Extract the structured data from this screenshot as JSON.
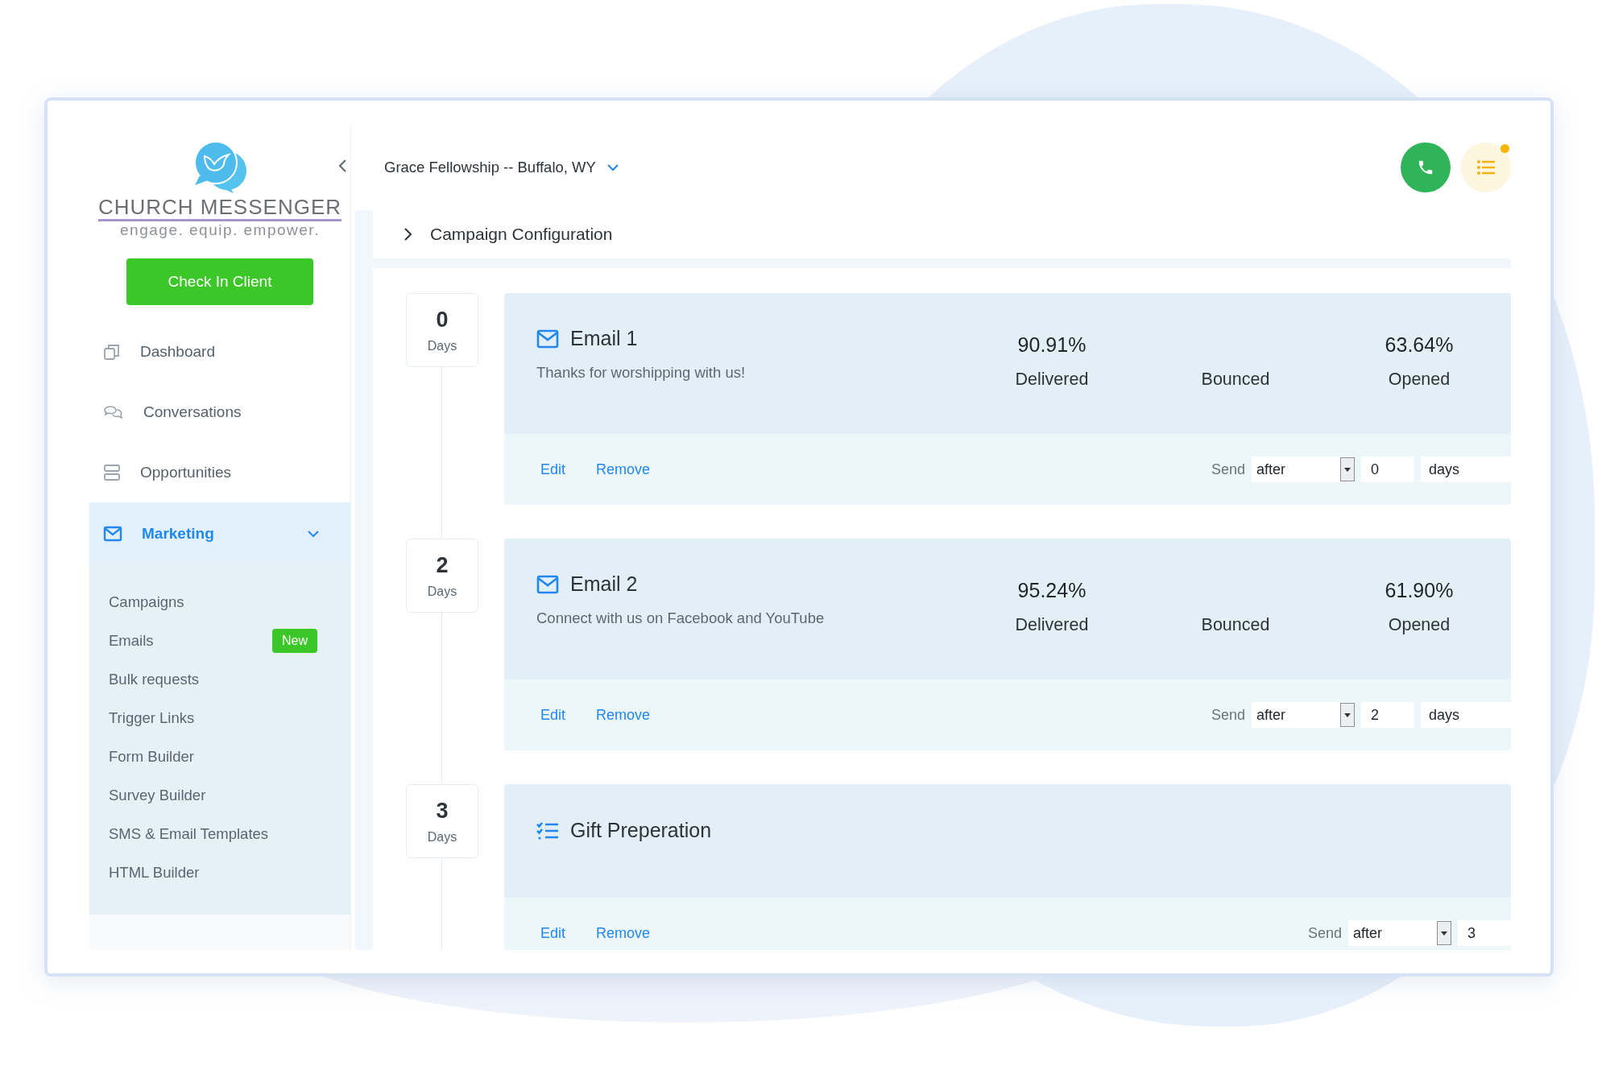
{
  "sidebar": {
    "logo": {
      "name": "CHURCH MESSENGER",
      "tagline": "engage. equip. empower."
    },
    "check_in_button": "Check In Client",
    "nav": [
      {
        "label": "Dashboard",
        "selected": false
      },
      {
        "label": "Conversations",
        "selected": false
      },
      {
        "label": "Opportunities",
        "selected": false
      },
      {
        "label": "Marketing",
        "selected": true,
        "expanded": true,
        "children": [
          {
            "label": "Campaigns"
          },
          {
            "label": "Emails",
            "badge": "New"
          },
          {
            "label": "Bulk requests"
          },
          {
            "label": "Trigger Links"
          },
          {
            "label": "Form Builder"
          },
          {
            "label": "Survey Builder"
          },
          {
            "label": "SMS & Email Templates"
          },
          {
            "label": "HTML Builder"
          }
        ]
      }
    ]
  },
  "header": {
    "location": "Grace Fellowship -- Buffalo, WY",
    "has_notification": true
  },
  "section": {
    "title": "Campaign Configuration",
    "expanded": false
  },
  "steps": [
    {
      "day": "0",
      "unit": "Days",
      "kind": "email",
      "title": "Email 1",
      "subtitle": "Thanks for worshipping with us!",
      "stats": [
        {
          "value": "90.91%",
          "label": "Delivered"
        },
        {
          "label": "Bounced"
        },
        {
          "value": "63.64%",
          "label": "Opened"
        }
      ],
      "actions": [
        "Edit",
        "Remove"
      ],
      "send": {
        "label": "Send",
        "when": "after",
        "count": "0",
        "unit": "days"
      }
    },
    {
      "day": "2",
      "unit": "Days",
      "kind": "email",
      "title": "Email 2",
      "subtitle": "Connect with us on Facebook and YouTube",
      "stats": [
        {
          "value": "95.24%",
          "label": "Delivered"
        },
        {
          "label": "Bounced"
        },
        {
          "value": "61.90%",
          "label": "Opened"
        }
      ],
      "actions": [
        "Edit",
        "Remove"
      ],
      "send": {
        "label": "Send",
        "when": "after",
        "count": "2",
        "unit": "days"
      }
    },
    {
      "day": "3",
      "unit": "Days",
      "kind": "task",
      "title": "Gift Preperation",
      "actions": [
        "Edit",
        "Remove"
      ],
      "send": {
        "label": "Send",
        "when": "after",
        "count": "3"
      }
    }
  ]
}
